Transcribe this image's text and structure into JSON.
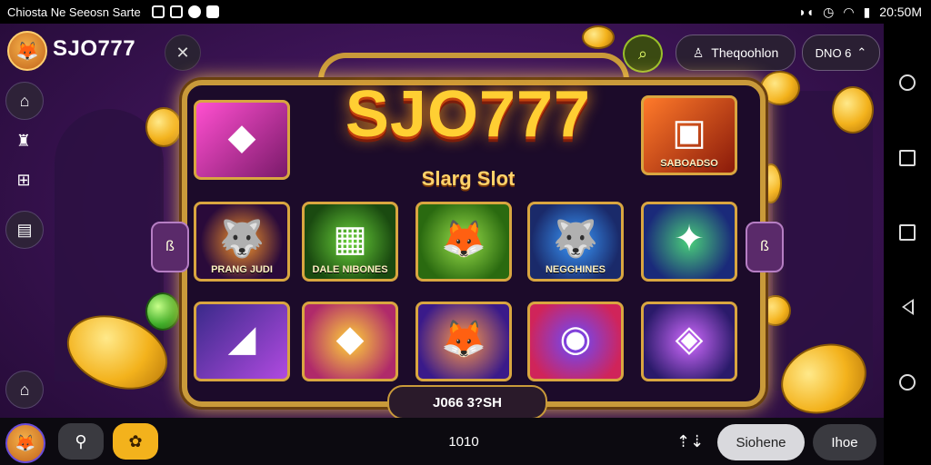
{
  "status_bar": {
    "title": "Chiosta Ne Seeosn Sarte",
    "time": "20:50M",
    "icons": [
      "gallery-icon",
      "message-icon",
      "record-icon",
      "cast-icon",
      "mute-icon",
      "alarm-icon",
      "wifi-icon",
      "battery-icon"
    ]
  },
  "app_bar": {
    "brand": "SJO777",
    "menu_icon": "close-cross-icon",
    "search_icon": "search-icon",
    "login_label": "Theqoohlon",
    "lang_label": "DNO 6",
    "accent": "#c99a3a"
  },
  "side_nav": {
    "items": [
      "home-icon",
      "trophy-icon",
      "gift-icon",
      "chat-icon"
    ],
    "bottom_item": "house-alert-icon"
  },
  "game": {
    "title": "SJO777",
    "subtitle": "Slarg Slot",
    "tiles": [
      {
        "caption": "",
        "icon": "pink-gem-card-icon"
      },
      {
        "caption": "SABOADSO",
        "icon": "treasure-chest-icon"
      },
      {
        "caption": "PRANG JUDI",
        "icon": "golden-wolf-icon"
      },
      {
        "caption": "DALE NIBONES",
        "icon": "silver-card-icon"
      },
      {
        "caption": "",
        "icon": "fox-icon"
      },
      {
        "caption": "NEGGHINES",
        "icon": "armored-wolf-icon"
      },
      {
        "caption": "",
        "icon": "green-emblem-icon"
      },
      {
        "caption": "",
        "icon": "purple-card-icon"
      },
      {
        "caption": "",
        "icon": "gold-gem-icon"
      },
      {
        "caption": "",
        "icon": "fox-hat-icon"
      },
      {
        "caption": "",
        "icon": "portal-orb-icon"
      },
      {
        "caption": "",
        "icon": "purple-crystal-icon"
      }
    ],
    "left_arrow": "ß",
    "right_arrow": "ß",
    "jackpot": "J066 3?SH"
  },
  "bottom_bar": {
    "avatar_icon": "fox-avatar-icon",
    "btn1_icon": "location-icon",
    "btn2_icon": "paw-icon",
    "center_number": "1010",
    "share_icon": "share-icon",
    "pill1_label": "Siohene",
    "pill2_label": "Ihoe"
  },
  "android_nav": [
    "circle-icon",
    "square-icon",
    "square-icon",
    "back-icon",
    "home-circle-icon"
  ]
}
